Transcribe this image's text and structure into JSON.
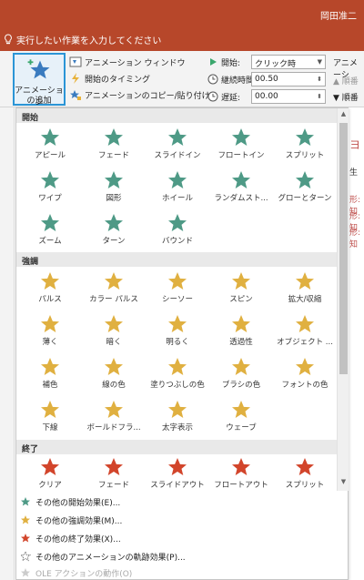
{
  "app": {
    "user": "岡田准二",
    "tellme": "実行したい作業を入力してください"
  },
  "ribbon": {
    "add_animation": [
      "アニメーション",
      "の追加"
    ],
    "anim_window": "アニメーション ウィンドウ",
    "trigger": "開始のタイミング",
    "painter": "アニメーションのコピー/貼り付け",
    "start_label": "開始:",
    "start_value": "クリック時",
    "duration_label": "継続時間:",
    "duration_value": "00.50",
    "delay_label": "遅延:",
    "delay_value": "00.00",
    "reorder": "アニメーシ",
    "order_earlier": "順番",
    "order_later": "順番"
  },
  "side": {
    "tab": "ヨ",
    "sub": "生",
    "rows": [
      "形: 知",
      "形: 知",
      "形: 知"
    ]
  },
  "gallery": {
    "sections": {
      "entrance": "開始",
      "emphasis": "強調",
      "exit": "終了"
    },
    "entrance": [
      "アピール",
      "フェード",
      "スライドイン",
      "フロートイン",
      "スプリット",
      "ワイプ",
      "図形",
      "ホイール",
      "ランダムスト...",
      "グローとターン",
      "ズーム",
      "ターン",
      "バウンド"
    ],
    "emphasis": [
      "パルス",
      "カラー パルス",
      "シーソー",
      "スピン",
      "拡大/収縮",
      "薄く",
      "暗く",
      "明るく",
      "透過性",
      "オブジェクト ...",
      "補色",
      "線の色",
      "塗りつぶしの色",
      "ブラシの色",
      "フォントの色",
      "下線",
      "ボールドフラ...",
      "太字表示",
      "ウェーブ"
    ],
    "exit": [
      "クリア",
      "フェード",
      "スライドアウト",
      "フロートアウト",
      "スプリット"
    ]
  },
  "menu": [
    "その他の開始効果(E)...",
    "その他の強調効果(M)...",
    "その他の終了効果(X)...",
    "その他のアニメーションの軌跡効果(P)...",
    "OLE アクションの動作(O)"
  ],
  "colors": {
    "title_bg": "#b7472a",
    "entrance": "#4e9a86",
    "emphasis": "#e0b040",
    "exit": "#d2452b",
    "selection": "#2b95d6"
  }
}
